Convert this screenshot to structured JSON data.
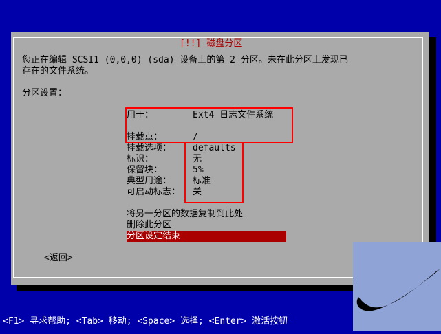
{
  "dialog": {
    "title_left_bracket": "[!!]",
    "title": "磁盘分区",
    "description_line1": "您正在编辑 SCSI1 (0,0,0) (sda) 设备上的第 2 分区。未在此分区上发现已",
    "description_line2": "存在的文件系统。",
    "section_label": "分区设置："
  },
  "settings": [
    {
      "label": "用于：",
      "value": "Ext4 日志文件系统"
    },
    {
      "label": "挂载点：",
      "value": "/"
    },
    {
      "label": "挂载选项：",
      "value": "defaults"
    },
    {
      "label": "标识：",
      "value": "无"
    },
    {
      "label": "保留块：",
      "value": "5%"
    },
    {
      "label": "典型用途：",
      "value": "标准"
    },
    {
      "label": "可启动标志：",
      "value": "关"
    }
  ],
  "actions": [
    {
      "label": "将另一分区的数据复制到此处"
    },
    {
      "label": "删除此分区"
    },
    {
      "label": "分区设定结束",
      "selected": true
    }
  ],
  "back_button": "<返回>",
  "status_bar": "<F1> 寻求帮助; <Tab> 移动; <Space> 选择; <Enter> 激活按钮",
  "colors": {
    "background": "#0000aa",
    "dialog": "#aaaaaa",
    "highlight": "#aa0000",
    "annotation_box": "#ff0000",
    "corner_patch": "#8fa3d6"
  }
}
